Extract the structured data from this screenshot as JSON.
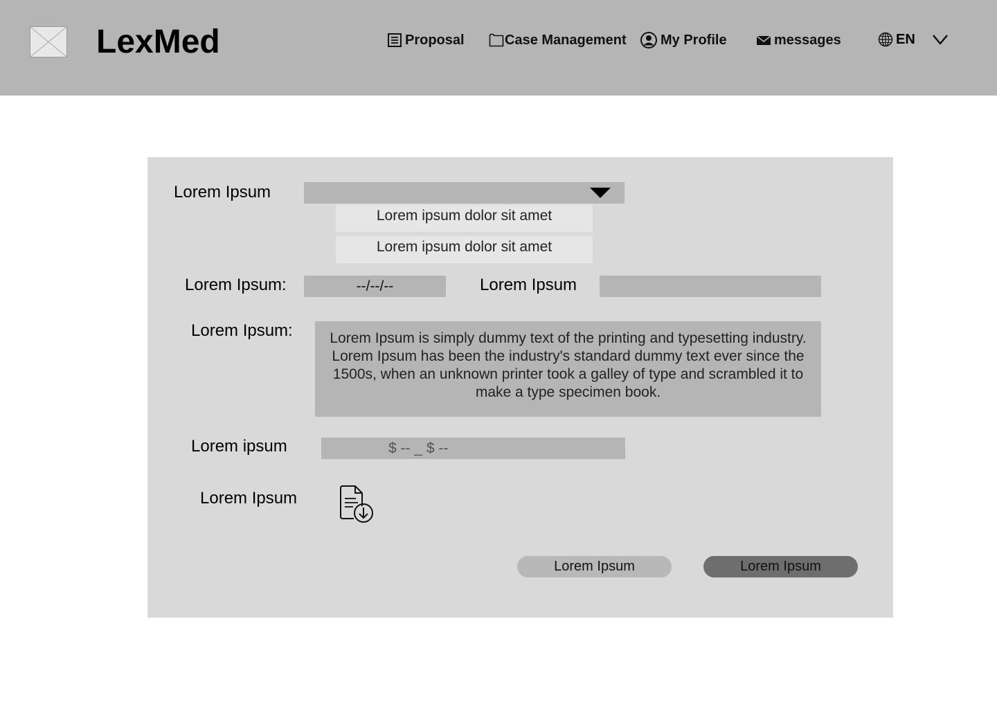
{
  "header": {
    "brand": "LexMed",
    "logo_icon": "image-placeholder-icon",
    "nav": [
      {
        "label": "Proposal",
        "icon": "document-icon"
      },
      {
        "label": "Case Management",
        "icon": "folder-icon"
      },
      {
        "label": "My Profile",
        "icon": "user-circle-icon"
      },
      {
        "label": "messages",
        "icon": "envelope-icon"
      }
    ],
    "language": {
      "label": "EN",
      "icon": "globe-icon"
    }
  },
  "form": {
    "select_label": "Lorem Ipsum",
    "select_value": "",
    "options": [
      "Lorem ipsum dolor sit amet",
      "Lorem ipsum dolor sit amet"
    ],
    "date_label": "Lorem Ipsum:",
    "date_value": "--/--/--",
    "text_label": "Lorem Ipsum",
    "text_value": "",
    "description_label": "Lorem Ipsum:",
    "description_value": "Lorem Ipsum is simply dummy text of the printing and typesetting industry. Lorem Ipsum has been the industry's standard dummy text ever since the 1500s, when an unknown printer took a galley of type and scrambled it to make a type specimen book.",
    "price_label": "Lorem ipsum",
    "price_value": "$ -- _ $ --",
    "file_label": "Lorem Ipsum",
    "file_icon": "document-download-icon",
    "secondary_button": "Lorem Ipsum",
    "primary_button": "Lorem Ipsum"
  },
  "colors": {
    "header_bg": "#b5b5b5",
    "panel_bg": "#d9d9d9",
    "field_bg": "#b5b5b5",
    "option_bg": "#e6e6e6",
    "primary_button_bg": "#6e6e6e",
    "secondary_button_bg": "#b8b8b8"
  }
}
